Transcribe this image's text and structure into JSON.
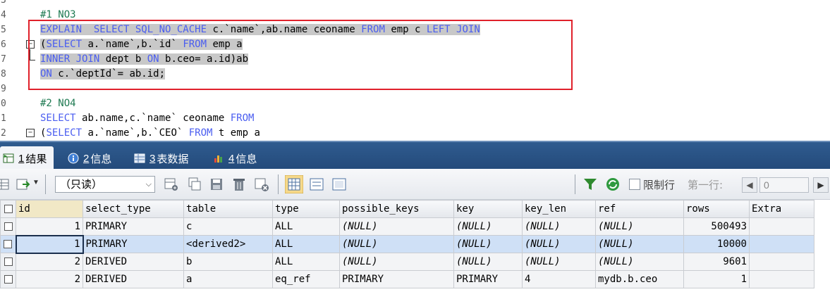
{
  "editor": {
    "lines": [
      {
        "num": "3",
        "segments": []
      },
      {
        "num": "4",
        "segments": [
          {
            "t": "#1 NO3",
            "c": "cm"
          }
        ]
      },
      {
        "num": "5",
        "segments": [
          {
            "t": "EXPLAIN  SELECT SQL_NO_CACHE ",
            "c": "kw"
          },
          {
            "t": "c.`name`,ab.name ceoname ",
            "c": "tx"
          },
          {
            "t": "FROM ",
            "c": "kw"
          },
          {
            "t": "emp c ",
            "c": "tx"
          },
          {
            "t": "LEFT JOIN",
            "c": "kw"
          }
        ],
        "selected": true
      },
      {
        "num": "6",
        "segments": [
          {
            "t": "(",
            "c": "tx"
          },
          {
            "t": "SELECT ",
            "c": "kw"
          },
          {
            "t": "a.`name`,b.`id` ",
            "c": "tx"
          },
          {
            "t": "FROM ",
            "c": "kw"
          },
          {
            "t": "emp a",
            "c": "tx"
          }
        ],
        "selected": true
      },
      {
        "num": "7",
        "segments": [
          {
            "t": "INNER JOIN ",
            "c": "kw"
          },
          {
            "t": "dept b ",
            "c": "tx"
          },
          {
            "t": "ON ",
            "c": "kw"
          },
          {
            "t": "b.ceo= a.id)ab",
            "c": "tx"
          }
        ],
        "selected": true
      },
      {
        "num": "8",
        "segments": [
          {
            "t": "ON ",
            "c": "kw"
          },
          {
            "t": "c.`deptId`= ab.id;",
            "c": "tx"
          }
        ],
        "selected": true
      },
      {
        "num": "9",
        "segments": []
      },
      {
        "num": "0",
        "segments": [
          {
            "t": "#2 NO4",
            "c": "cm"
          }
        ]
      },
      {
        "num": "1",
        "segments": [
          {
            "t": "SELECT ",
            "c": "kw"
          },
          {
            "t": "ab.name,c.`name` ceoname ",
            "c": "tx"
          },
          {
            "t": "FROM",
            "c": "kw"
          }
        ]
      },
      {
        "num": "2",
        "segments": [
          {
            "t": "(",
            "c": "tx"
          },
          {
            "t": "SELECT ",
            "c": "kw"
          },
          {
            "t": "a.`name`,b.`CEO` ",
            "c": "tx"
          },
          {
            "t": "FROM ",
            "c": "kw"
          },
          {
            "t": "t emp a",
            "c": "tx"
          }
        ]
      }
    ]
  },
  "tabs": [
    {
      "num": "1",
      "label": "结果"
    },
    {
      "num": "2",
      "label": "信息"
    },
    {
      "num": "3",
      "label": "表数据"
    },
    {
      "num": "4",
      "label": "信息"
    }
  ],
  "toolbar": {
    "mode_select": "（只读）",
    "limit_rows_label": "限制行",
    "first_row_label": "第一行:",
    "first_row_value": "0"
  },
  "grid": {
    "columns": [
      "id",
      "select_type",
      "table",
      "type",
      "possible_keys",
      "key",
      "key_len",
      "ref",
      "rows",
      "Extra"
    ],
    "rows": [
      [
        "1",
        "PRIMARY",
        "c",
        "ALL",
        "(NULL)",
        "(NULL)",
        "(NULL)",
        "(NULL)",
        "500493",
        ""
      ],
      [
        "1",
        "PRIMARY",
        "<derived2>",
        "ALL",
        "(NULL)",
        "(NULL)",
        "(NULL)",
        "(NULL)",
        "10000",
        ""
      ],
      [
        "2",
        "DERIVED",
        "b",
        "ALL",
        "(NULL)",
        "(NULL)",
        "(NULL)",
        "(NULL)",
        "9601",
        ""
      ],
      [
        "2",
        "DERIVED",
        "a",
        "eq_ref",
        "PRIMARY",
        "PRIMARY",
        "4",
        "mydb.b.ceo",
        "1",
        ""
      ]
    ],
    "selected_row": 1
  },
  "colors": {
    "keyword": "#4a5df0",
    "comment": "#1f7a52",
    "highlight_box": "#e0212b",
    "tab_bar": "#2f5b8f"
  }
}
